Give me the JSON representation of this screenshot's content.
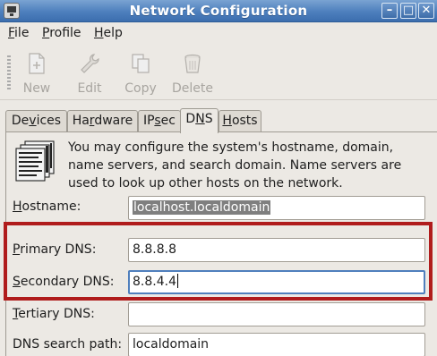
{
  "window": {
    "title": "Network Configuration",
    "controls": {
      "minimize": "–",
      "maximize": "□",
      "close": "✕"
    }
  },
  "menu": {
    "file": {
      "mnemonic": "F",
      "rest": "ile"
    },
    "profile": {
      "mnemonic": "P",
      "rest": "rofile"
    },
    "help": {
      "mnemonic": "H",
      "rest": "elp"
    }
  },
  "toolbar": {
    "new": "New",
    "edit": "Edit",
    "copy": "Copy",
    "delete": "Delete",
    "icons": {
      "new": "new-document-icon",
      "edit": "wrench-icon",
      "copy": "copy-icon",
      "delete": "trash-icon"
    },
    "disabled_color": "#a8a5a0"
  },
  "tabs": {
    "devices": {
      "pre": "De",
      "mnemonic": "v",
      "post": "ices"
    },
    "hardware": {
      "pre": "Ha",
      "mnemonic": "r",
      "post": "dware"
    },
    "ipsec": {
      "pre": "IP",
      "mnemonic": "s",
      "post": "ec"
    },
    "dns": {
      "pre": "D",
      "mnemonic": "N",
      "post": "S"
    },
    "hosts": {
      "pre": "",
      "mnemonic": "H",
      "post": "osts"
    }
  },
  "dns_panel": {
    "description": "You may configure the system's hostname, domain, name servers, and search domain. Name servers are used to look up other hosts on the network.",
    "hostname": {
      "mnemonic": "H",
      "rest": "ostname:",
      "value": "localhost.localdomain"
    },
    "primary_dns": {
      "mnemonic": "P",
      "rest": "rimary DNS:",
      "value": "8.8.8.8"
    },
    "secondary_dns": {
      "mnemonic": "S",
      "rest": "econdary DNS:",
      "value": "8.8.4.4"
    },
    "tertiary_dns": {
      "mnemonic": "T",
      "rest": "ertiary DNS:",
      "value": ""
    },
    "search_path": {
      "label": "DNS search path:",
      "value": "localdomain"
    }
  },
  "colors": {
    "highlight": "#b01c1c",
    "titlebar": "#4d7fbd",
    "focus": "#4f7fbd"
  }
}
